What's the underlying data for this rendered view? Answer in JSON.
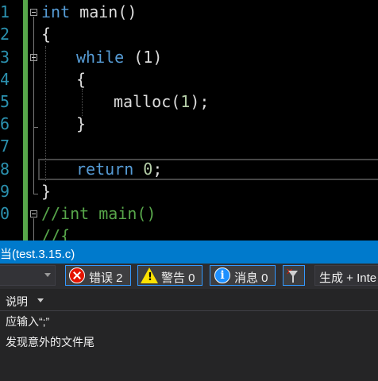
{
  "editor": {
    "line_numbers": [
      "1",
      "2",
      "3",
      "4",
      "5",
      "6",
      "7",
      "8",
      "9",
      "0"
    ],
    "lines": [
      {
        "kw": "int",
        "rest": " main()"
      },
      {
        "text": "{"
      },
      {
        "kw": "while",
        "rest": " (1)"
      },
      {
        "text": "{"
      },
      {
        "fn": "malloc",
        "num": "1"
      },
      {
        "text": "}"
      },
      {
        "text": ""
      },
      {
        "kw": "return",
        "num": "0"
      },
      {
        "text": "}"
      },
      {
        "comment": "//int main()"
      },
      {
        "comment": "//{"
      }
    ]
  },
  "panel": {
    "title": "当(test.3.15.c)"
  },
  "toolbar": {
    "errors_label": "错误 2",
    "warnings_label": "警告 0",
    "messages_label": "消息 0",
    "build_label": "生成 + Inte"
  },
  "error_list": {
    "column_header": "说明",
    "rows": [
      "应输入“;”",
      "发现意外的文件尾"
    ]
  },
  "colors": {
    "keyword": "#569cd6",
    "comment": "#57a64a",
    "number": "#b5cea8",
    "line_number": "#2b91af",
    "panel_title_bg": "#007acc",
    "error_icon": "#e51400",
    "warning_icon": "#fce100",
    "info_icon": "#1e90ff"
  }
}
